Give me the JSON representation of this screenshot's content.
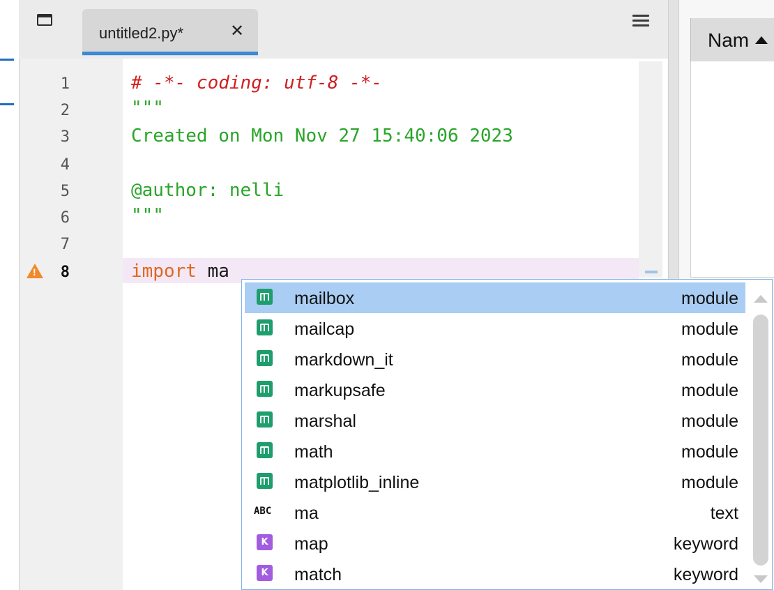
{
  "tab": {
    "title": "untitled2.py*",
    "close_glyph": "✕"
  },
  "icons": {
    "window": "window-icon",
    "menu": "hamburger-menu-icon",
    "warning": "warning-icon",
    "close": "close-icon"
  },
  "colors": {
    "comment": "#d01f1f",
    "docstring": "#2aa52a",
    "keyword": "#e0681f",
    "current_line": "#f4e8f6",
    "selection": "#a9cdf3",
    "module_icon": "#1e9e6c",
    "keyword_icon": "#a25ce0",
    "tab_accent": "#3b89d8",
    "warning": "#f0892a"
  },
  "editor": {
    "line_numbers": [
      "1",
      "2",
      "3",
      "4",
      "5",
      "6",
      "7",
      "8"
    ],
    "lines": [
      {
        "segments": [
          {
            "text": "# -*- coding: utf-8 -*-",
            "kind": "comment"
          }
        ]
      },
      {
        "segments": [
          {
            "text": "\"\"\"",
            "kind": "doc"
          }
        ]
      },
      {
        "segments": [
          {
            "text": "Created on Mon Nov 27 15:40:06 2023",
            "kind": "doc"
          }
        ]
      },
      {
        "segments": []
      },
      {
        "segments": [
          {
            "text": "@author: nelli",
            "kind": "doc"
          }
        ]
      },
      {
        "segments": [
          {
            "text": "\"\"\"",
            "kind": "doc"
          }
        ]
      },
      {
        "segments": []
      },
      {
        "segments": [
          {
            "text": "import",
            "kind": "kw"
          },
          {
            "text": " ma",
            "kind": "plain"
          }
        ]
      }
    ],
    "warning_line": "8"
  },
  "right_pane": {
    "column_header": "Nam"
  },
  "completions": {
    "items": [
      {
        "name": "mailbox",
        "kind": "module",
        "icon": "module",
        "icon_text": "",
        "selected": true
      },
      {
        "name": "mailcap",
        "kind": "module",
        "icon": "module",
        "icon_text": ""
      },
      {
        "name": "markdown_it",
        "kind": "module",
        "icon": "module",
        "icon_text": ""
      },
      {
        "name": "markupsafe",
        "kind": "module",
        "icon": "module",
        "icon_text": ""
      },
      {
        "name": "marshal",
        "kind": "module",
        "icon": "module",
        "icon_text": ""
      },
      {
        "name": "math",
        "kind": "module",
        "icon": "module",
        "icon_text": ""
      },
      {
        "name": "matplotlib_inline",
        "kind": "module",
        "icon": "module",
        "icon_text": ""
      },
      {
        "name": "ma",
        "kind": "text",
        "icon": "text",
        "icon_text": "ABC"
      },
      {
        "name": "map",
        "kind": "keyword",
        "icon": "keyword",
        "icon_text": "K"
      },
      {
        "name": "match",
        "kind": "keyword",
        "icon": "keyword",
        "icon_text": "K"
      }
    ]
  }
}
